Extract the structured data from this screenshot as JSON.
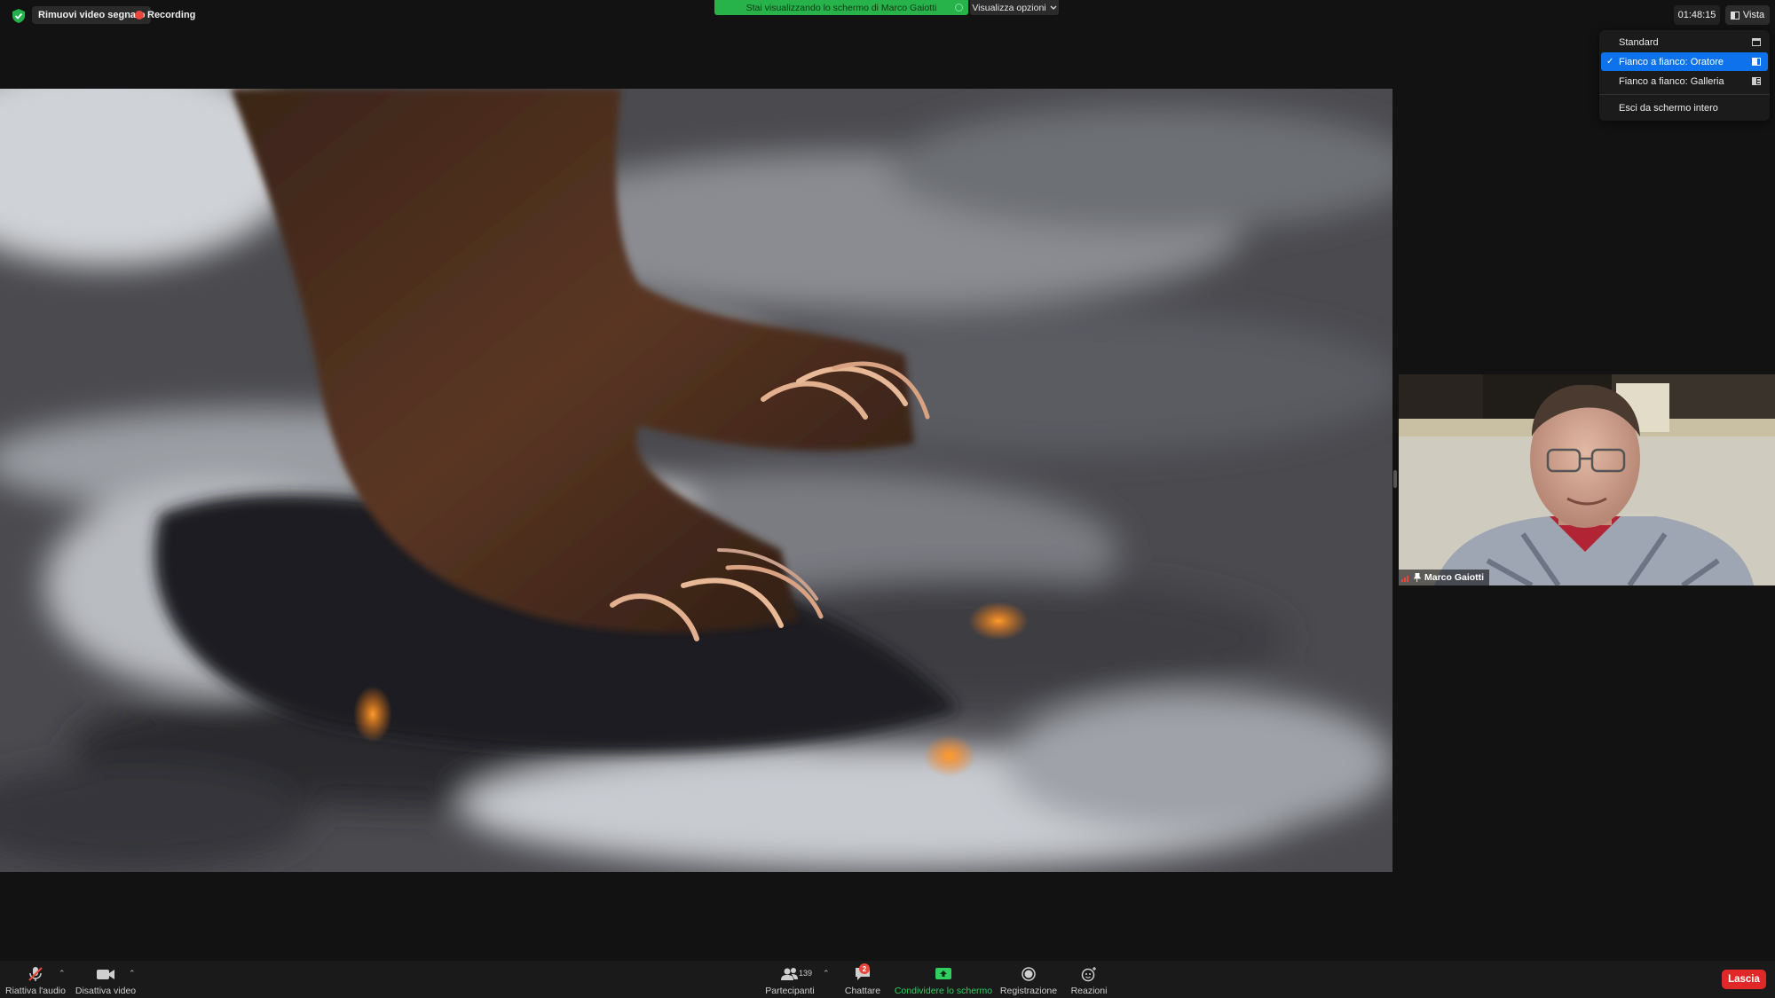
{
  "top_bar": {
    "remove_video_label": "Rimuovi video segnato",
    "recording_label": "Recording",
    "share_banner_text": "Stai visualizzando lo schermo di Marco Gaiotti",
    "view_options_label": "Visualizza opzioni",
    "clock": "01:48:15",
    "view_button_label": "Vista"
  },
  "view_menu": {
    "items": [
      {
        "label": "Standard",
        "selected": false
      },
      {
        "label": "Fianco a fianco: Oratore",
        "selected": true
      },
      {
        "label": "Fianco a fianco: Galleria",
        "selected": false
      }
    ],
    "exit_fullscreen_label": "Esci da schermo intero"
  },
  "participant": {
    "name": "Marco Gaiotti"
  },
  "toolbar": {
    "audio_label": "Riattiva l'audio",
    "video_label": "Disattiva video",
    "participants_label": "Partecipanti",
    "participants_count": "139",
    "chat_label": "Chattare",
    "chat_badge": "2",
    "share_label": "Condividere lo schermo",
    "record_label": "Registrazione",
    "reactions_label": "Reazioni",
    "leave_label": "Lascia"
  },
  "colors": {
    "accent_blue": "#0e72ed",
    "share_green": "#27b24a",
    "recording_red": "#e8473c",
    "leave_red": "#e02828"
  }
}
